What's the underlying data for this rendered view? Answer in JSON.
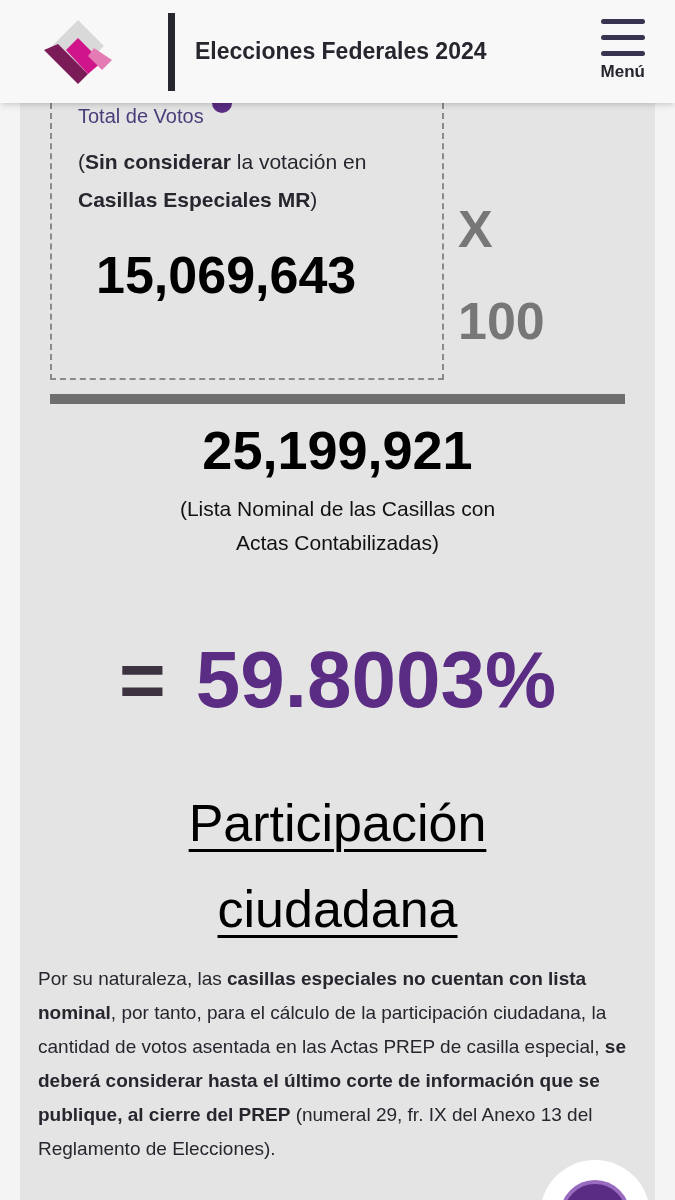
{
  "header": {
    "title": "Elecciones Federales 2024",
    "menu_label": "Menú"
  },
  "formula": {
    "numerator_label": "Total de Votos",
    "numerator_note": "(**Sin considerar** la votación en **Casillas Especiales MR**)",
    "numerator_value": "15,069,643",
    "operator": "X",
    "multiplier": "100",
    "denominator_value": "25,199,921",
    "denominator_note": "(Lista Nominal de las Casillas con Actas Contabilizadas)",
    "equals": "=",
    "result": "59.8003%"
  },
  "heading": "Participación ciudadana",
  "paragraph": "Por su naturaleza, las **casillas especiales no cuentan con lista nominal**, por tanto, para el cálculo de la participación ciudadana, la cantidad de votos asentada en las Actas PREP de casilla especial, **se deberá considerar hasta el último corte de información que se publique, al cierre del PREP** (numeral 29, fr. IX del Anexo 13 del Reglamento de Elecciones)."
}
